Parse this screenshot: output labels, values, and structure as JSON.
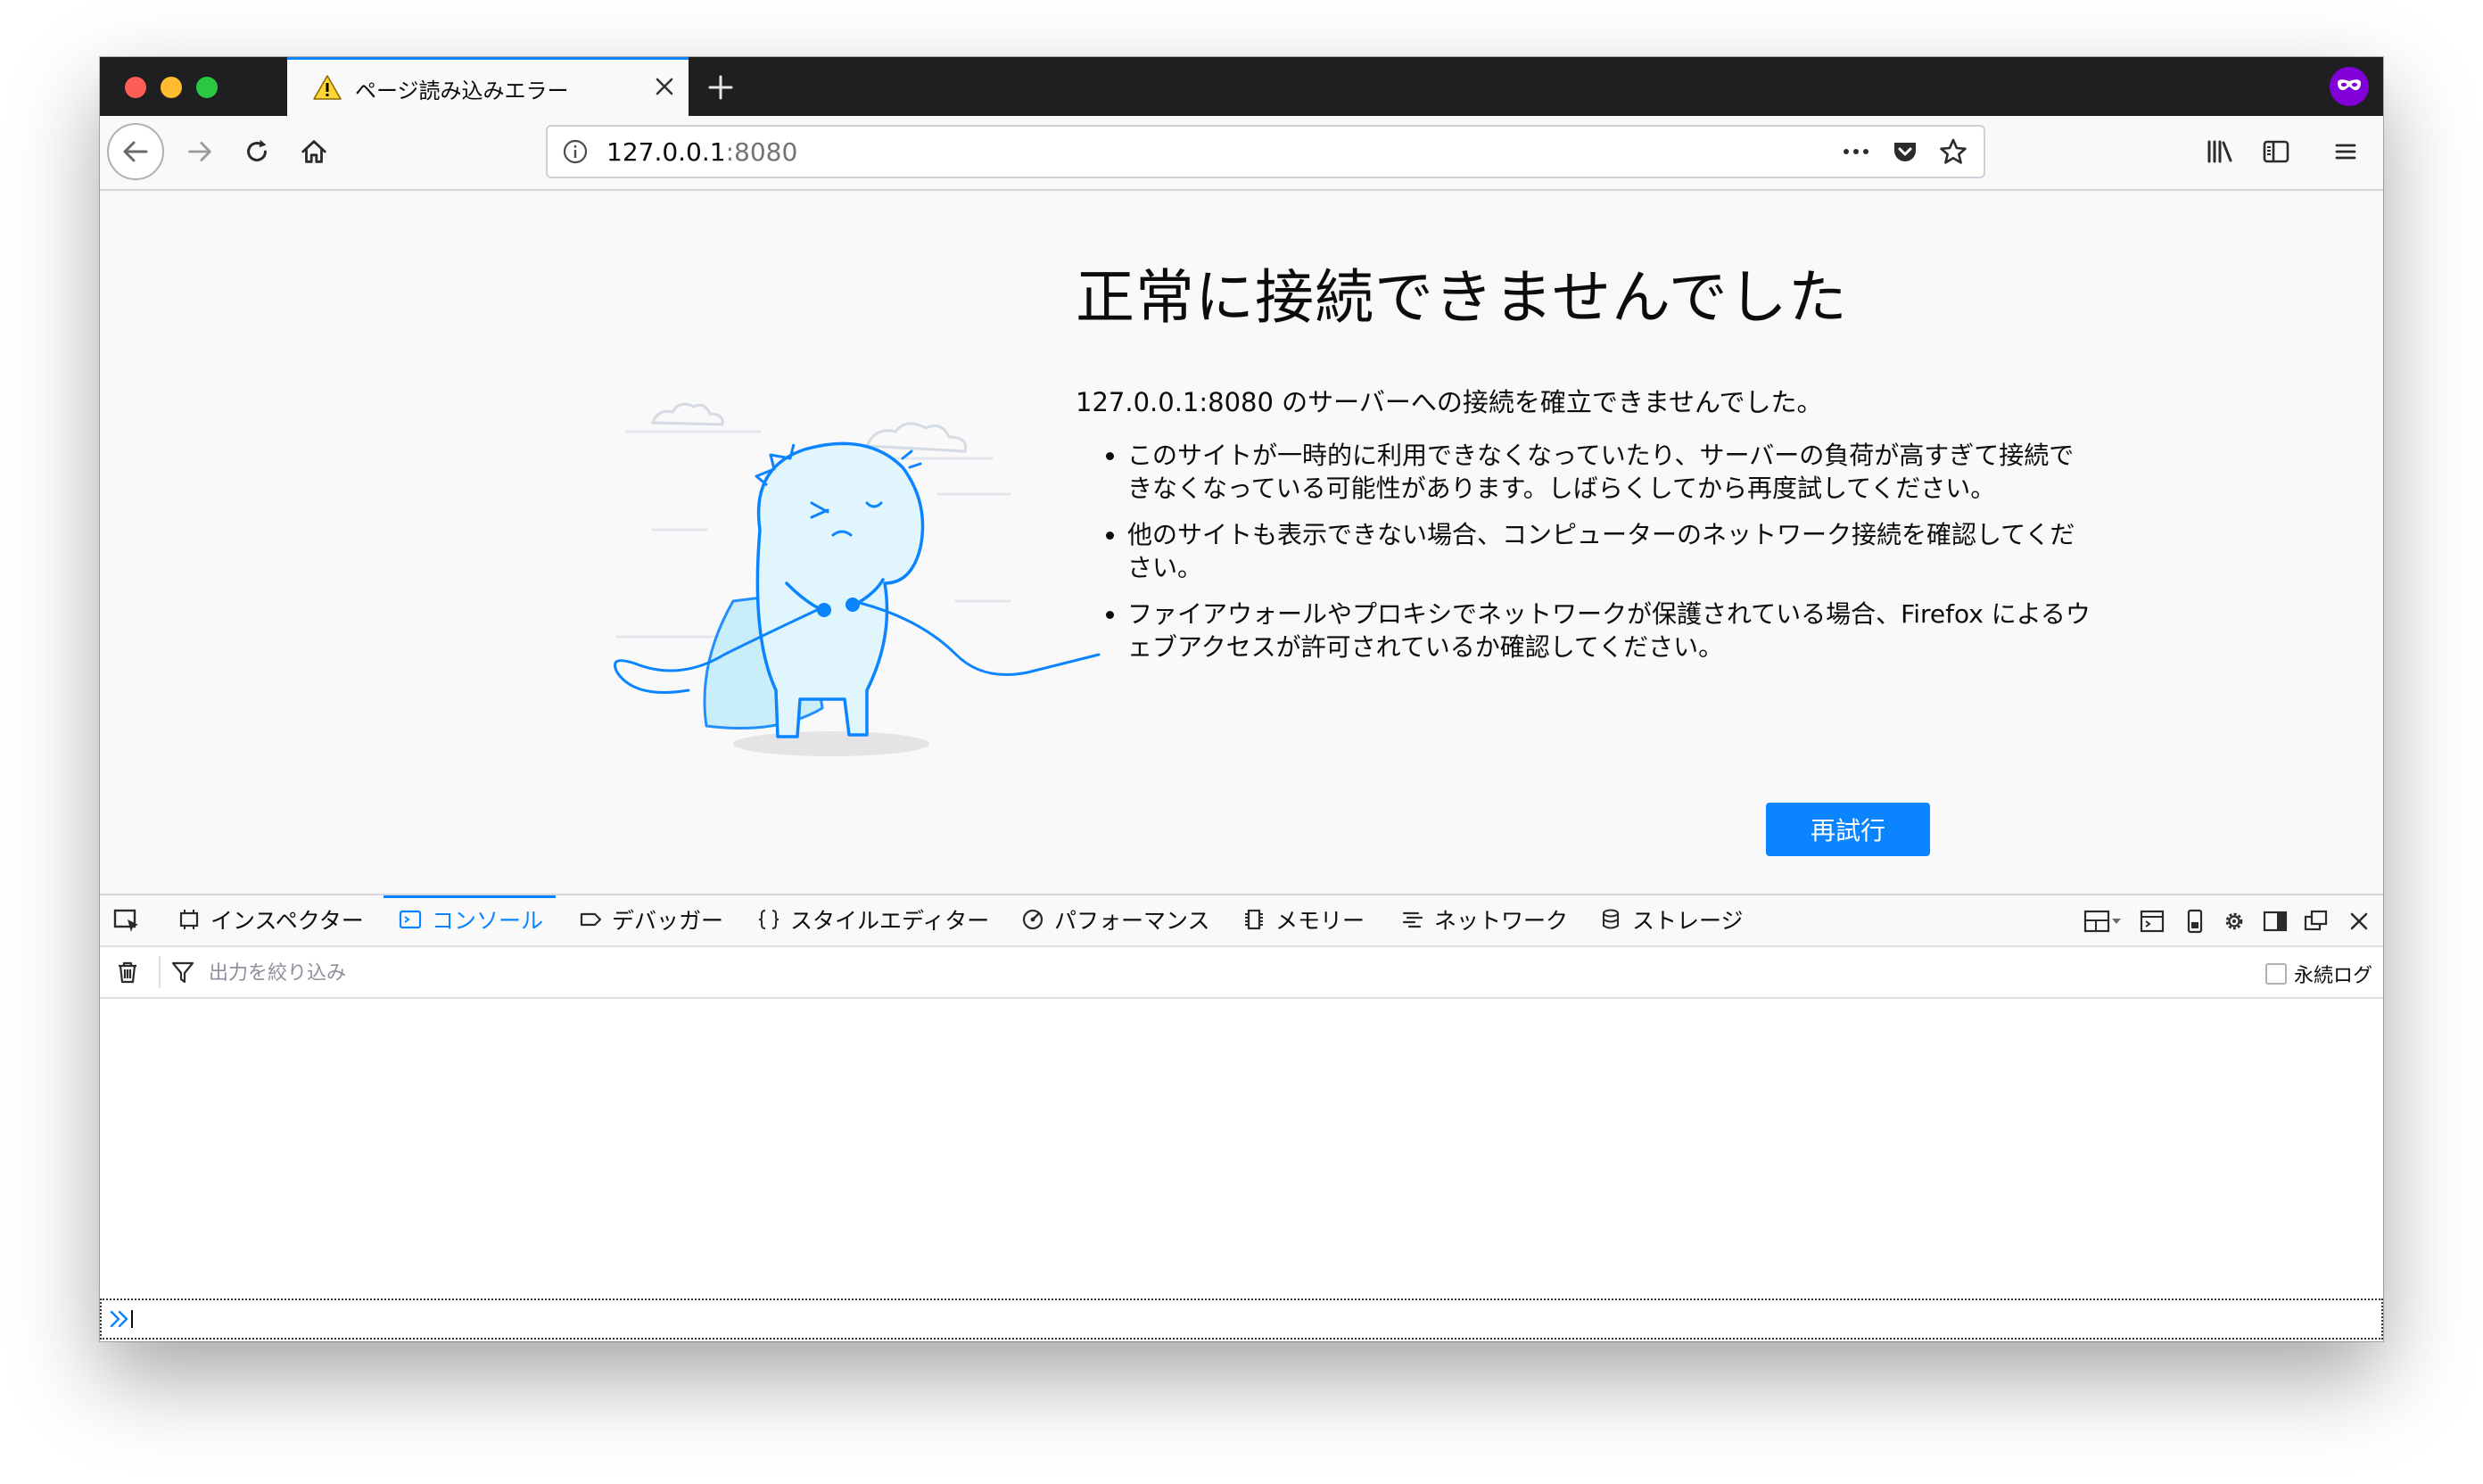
{
  "window": {
    "active_tab_title": "ページ読み込みエラー",
    "accent_color": "#0a84ff"
  },
  "navbar": {
    "url_host": "127.0.0.1",
    "url_port": ":8080"
  },
  "error_page": {
    "title": "正常に接続できませんでした",
    "description": "127.0.0.1:8080 のサーバーへの接続を確立できませんでした。",
    "bullets": [
      "このサイトが一時的に利用できなくなっていたり、サーバーの負荷が高すぎて接続できなくなっている可能性があります。しばらくしてから再度試してください。",
      "他のサイトも表示できない場合、コンピューターのネットワーク接続を確認してください。",
      "ファイアウォールやプロキシでネットワークが保護されている場合、Firefox によるウェブアクセスが許可されているか確認してください。"
    ],
    "retry_label": "再試行"
  },
  "devtools": {
    "tabs": [
      {
        "label": "インスペクター",
        "icon": "inspector-icon"
      },
      {
        "label": "コンソール",
        "icon": "console-icon",
        "active": true
      },
      {
        "label": "デバッガー",
        "icon": "debugger-icon"
      },
      {
        "label": "スタイルエディター",
        "icon": "braces-icon"
      },
      {
        "label": "パフォーマンス",
        "icon": "performance-icon"
      },
      {
        "label": "メモリー",
        "icon": "memory-chip-icon"
      },
      {
        "label": "ネットワーク",
        "icon": "network-icon"
      },
      {
        "label": "ストレージ",
        "icon": "storage-icon"
      }
    ],
    "filter_placeholder": "出力を絞り込み",
    "persist_logs_label": "永続ログ"
  }
}
